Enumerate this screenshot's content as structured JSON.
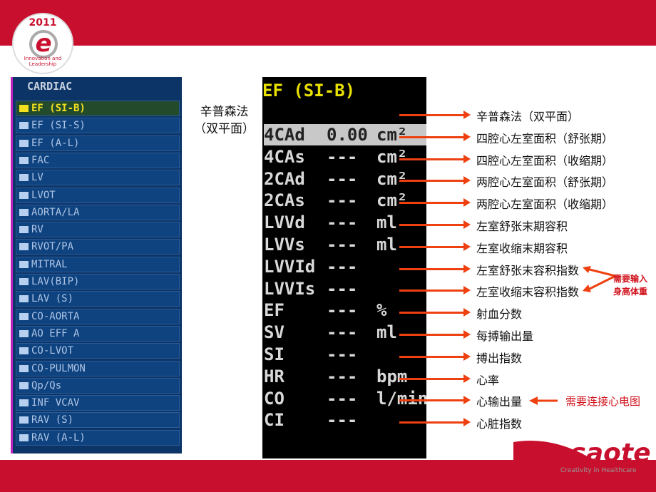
{
  "badge": {
    "year": "2011",
    "letter": "e",
    "tagline": "Innovation and Leadership"
  },
  "menu": {
    "header": "CARDIAC",
    "items": [
      "EF (SI-B)",
      "EF (SI-S)",
      "EF (A-L)",
      "FAC",
      "LV",
      "LVOT",
      "AORTA/LA",
      "RV",
      "RVOT/PA",
      "MITRAL",
      "LAV(BIP)",
      "LAV (S)",
      "CO-AORTA",
      "AO EFF A",
      "CO-LVOT",
      "CO-PULMON",
      "Qp/Qs",
      "INF VCAV",
      "RAV (S)",
      "RAV (A-L)"
    ],
    "selected": 0
  },
  "caption": {
    "line1": "辛普森法",
    "line2": "（双平面）"
  },
  "screen": {
    "title": "EF (SI-B)",
    "rows": [
      {
        "name": "4CAd",
        "value": "0.00",
        "unit": "cm²"
      },
      {
        "name": "4CAs",
        "value": "---",
        "unit": "cm²"
      },
      {
        "name": "2CAd",
        "value": "---",
        "unit": "cm²"
      },
      {
        "name": "2CAs",
        "value": "---",
        "unit": "cm²"
      },
      {
        "name": "LVVd",
        "value": "---",
        "unit": "ml"
      },
      {
        "name": "LVVs",
        "value": "---",
        "unit": "ml"
      },
      {
        "name": "LVVId",
        "value": "---",
        "unit": ""
      },
      {
        "name": "LVVIs",
        "value": "---",
        "unit": ""
      },
      {
        "name": "EF",
        "value": "---",
        "unit": "%"
      },
      {
        "name": "SV",
        "value": "---",
        "unit": "ml"
      },
      {
        "name": "SI",
        "value": "---",
        "unit": ""
      },
      {
        "name": "HR",
        "value": "---",
        "unit": "bpm"
      },
      {
        "name": "CO",
        "value": "---",
        "unit": "l/min"
      },
      {
        "name": "CI",
        "value": "---",
        "unit": ""
      }
    ]
  },
  "labels": [
    "辛普森法（双平面）",
    "四腔心左室面积（舒张期）",
    "四腔心左室面积（收缩期）",
    "两腔心左室面积（舒张期）",
    "两腔心左室面积（收缩期）",
    "左室舒张末期容积",
    "左室收缩末期容积",
    "左室舒张末容积指数",
    "左室收缩末容积指数",
    "射血分数",
    "每搏输出量",
    "搏出指数",
    "心率",
    "心输出量",
    "心脏指数"
  ],
  "notes": {
    "height_weight_1": "需要输入",
    "height_weight_2": "身高体重",
    "ecg": "需要连接心电图"
  },
  "logo": {
    "name": "esaote",
    "tagline": "Creativity in Healthcare"
  },
  "colors": {
    "brand_red": "#c8102e",
    "arrow": "#ee4010",
    "menu_bg": "#0d3466",
    "highlight": "#f0e020"
  }
}
